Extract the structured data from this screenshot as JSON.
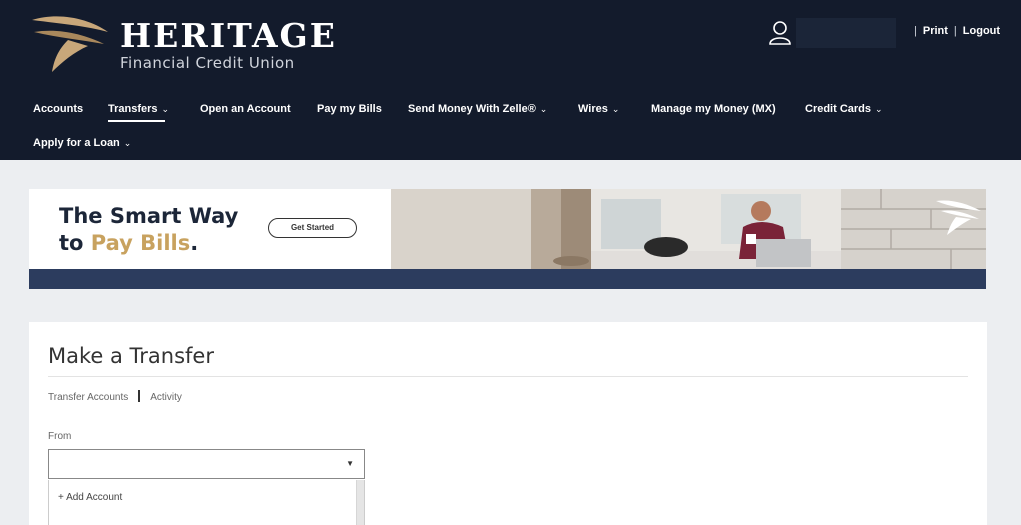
{
  "brand": {
    "name": "HERITAGE",
    "subtitle": "Financial Credit Union"
  },
  "utility": {
    "print_label": "Print",
    "logout_label": "Logout"
  },
  "nav": {
    "row1": [
      {
        "label": "Accounts",
        "has_dropdown": false
      },
      {
        "label": "Transfers",
        "has_dropdown": true,
        "active": true
      },
      {
        "label": "Open an Account",
        "has_dropdown": false
      },
      {
        "label": "Pay my Bills",
        "has_dropdown": false
      },
      {
        "label": "Send Money With Zelle®",
        "has_dropdown": true
      },
      {
        "label": "Wires",
        "has_dropdown": true
      },
      {
        "label": "Manage my Money (MX)",
        "has_dropdown": false
      },
      {
        "label": "Credit Cards",
        "has_dropdown": true
      }
    ],
    "row2": [
      {
        "label": "Apply for a Loan",
        "has_dropdown": true
      }
    ],
    "chevron_icon": "chevron-down-icon"
  },
  "banner": {
    "line1": "The Smart Way",
    "line2_prefix": "to ",
    "line2_accent": "Pay Bills",
    "line2_suffix": ".",
    "cta_label": "Get Started",
    "accent_color": "#c8a25f",
    "bar_color": "#2c3c5e"
  },
  "transfer": {
    "title": "Make a Transfer",
    "subnav": [
      "Transfer Accounts",
      "Activity"
    ],
    "from_label": "From",
    "from_value": "",
    "dropdown_options": [
      "+ Add Account"
    ]
  },
  "colors": {
    "header_bg": "#131b2c",
    "page_bg": "#eceef1"
  }
}
